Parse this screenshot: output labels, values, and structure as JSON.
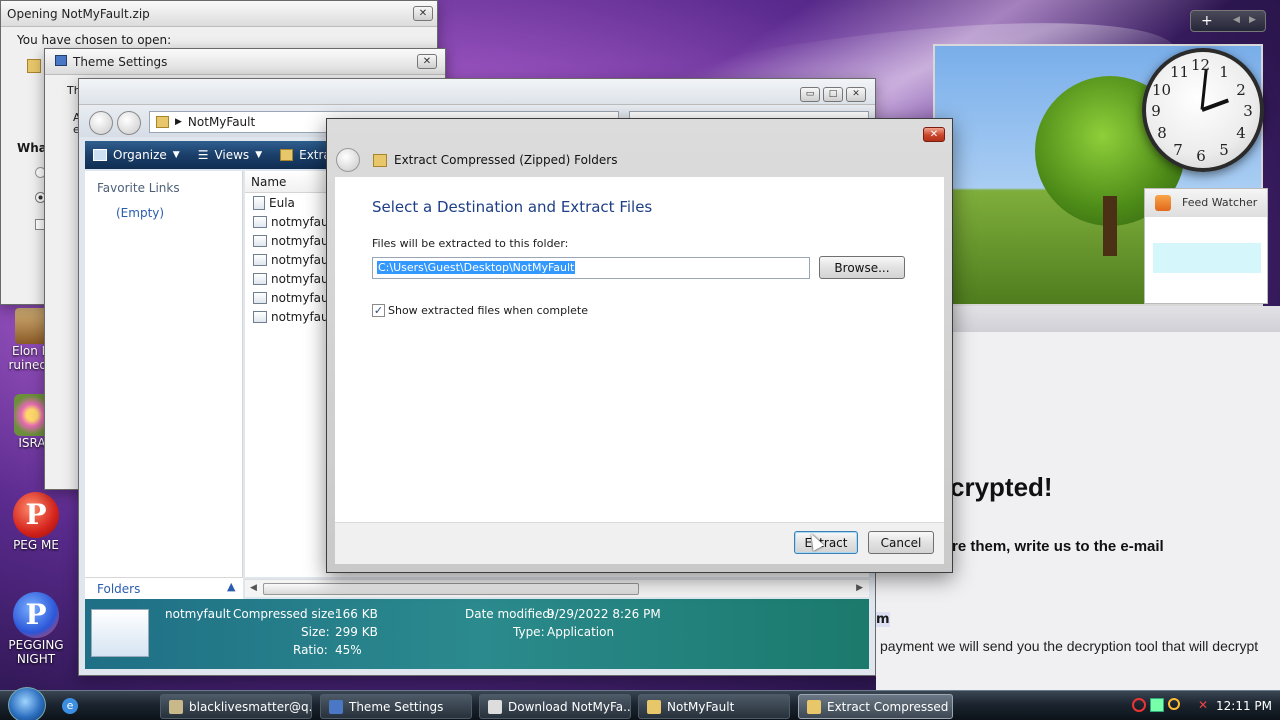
{
  "windows": {
    "opening": {
      "title": "Opening NotMyFault.zip",
      "text": "You have chosen to open:",
      "what": "What"
    },
    "theme_settings": {
      "title": "Theme Settings",
      "frag1": "Th",
      "frag2": "A",
      "frag3": "e"
    },
    "explorer": {
      "address": "NotMyFault",
      "toolbar": {
        "organize": "Organize",
        "views": "Views",
        "extract": "Extract"
      },
      "nav": {
        "favorite_links": "Favorite Links",
        "empty": "(Empty)",
        "folders": "Folders"
      },
      "column_name": "Name",
      "files": [
        "Eula",
        "notmyfault",
        "notmyfault",
        "notmyfault",
        "notmyfault",
        "notmyfault",
        "notmyfault"
      ],
      "details": {
        "name": "notmyfault",
        "compressed_size_label": "Compressed size:",
        "compressed_size": "166 KB",
        "size_label": "Size:",
        "size": "299 KB",
        "ratio_label": "Ratio:",
        "ratio": "45%",
        "date_modified_label": "Date modified:",
        "date_modified": "9/29/2022 8:26 PM",
        "type_label": "Type:",
        "type": "Application"
      }
    },
    "extract": {
      "title": "Extract Compressed (Zipped) Folders",
      "heading": "Select a Destination and Extract Files",
      "folder_label": "Files will be extracted to this folder:",
      "path": "C:\\Users\\Guest\\Desktop\\NotMyFault",
      "browse": "Browse...",
      "show_files": "Show extracted files when complete",
      "extract_btn": "Extract",
      "cancel_btn": "Cancel"
    }
  },
  "ransom": {
    "headline": "crypted!",
    "line1": "re them, write us to the e-mail",
    "line2": "m",
    "line3": "payment we will send you the decryption tool that will decrypt"
  },
  "gadgets": {
    "feed_watcher": "Feed Watcher",
    "clock_numbers": [
      "12",
      "1",
      "2",
      "3",
      "4",
      "5",
      "6",
      "7",
      "8",
      "9",
      "10",
      "11"
    ]
  },
  "desktop_icons": [
    {
      "label": "Elon M ruined t"
    },
    {
      "label": "ISRA"
    },
    {
      "label": "PEG ME"
    },
    {
      "label": "PEGGING NIGHT"
    }
  ],
  "taskbar": {
    "items": [
      {
        "label": "blacklivesmatter@q..."
      },
      {
        "label": "Theme Settings"
      },
      {
        "label": "Download NotMyFa..."
      },
      {
        "label": "NotMyFault"
      },
      {
        "label": "Extract Compressed ..."
      }
    ],
    "time": "12:11 PM"
  }
}
